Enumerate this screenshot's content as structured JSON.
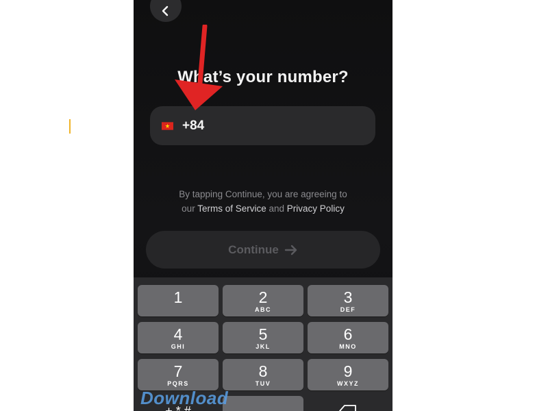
{
  "header": {
    "title": "What’s your number?"
  },
  "phone_input": {
    "flag": "vietnam-flag-icon",
    "value": "+84"
  },
  "terms": {
    "prefix": "By tapping Continue, you are agreeing to",
    "our": "our",
    "terms_link": "Terms of Service",
    "and": "and",
    "privacy_link": "Privacy Policy"
  },
  "continue_button": {
    "label": "Continue",
    "icon": "arrow-right-icon"
  },
  "keypad": {
    "keys": [
      {
        "digit": "1",
        "letters": ""
      },
      {
        "digit": "2",
        "letters": "ABC"
      },
      {
        "digit": "3",
        "letters": "DEF"
      },
      {
        "digit": "4",
        "letters": "GHI"
      },
      {
        "digit": "5",
        "letters": "JKL"
      },
      {
        "digit": "6",
        "letters": "MNO"
      },
      {
        "digit": "7",
        "letters": "PQRS"
      },
      {
        "digit": "8",
        "letters": "TUV"
      },
      {
        "digit": "9",
        "letters": "WXYZ"
      }
    ]
  },
  "watermark": {
    "text": "Download"
  },
  "colors": {
    "accent_caret": "#f0b429",
    "annotation_arrow": "#e02424",
    "watermark": "#5aa0e6"
  }
}
